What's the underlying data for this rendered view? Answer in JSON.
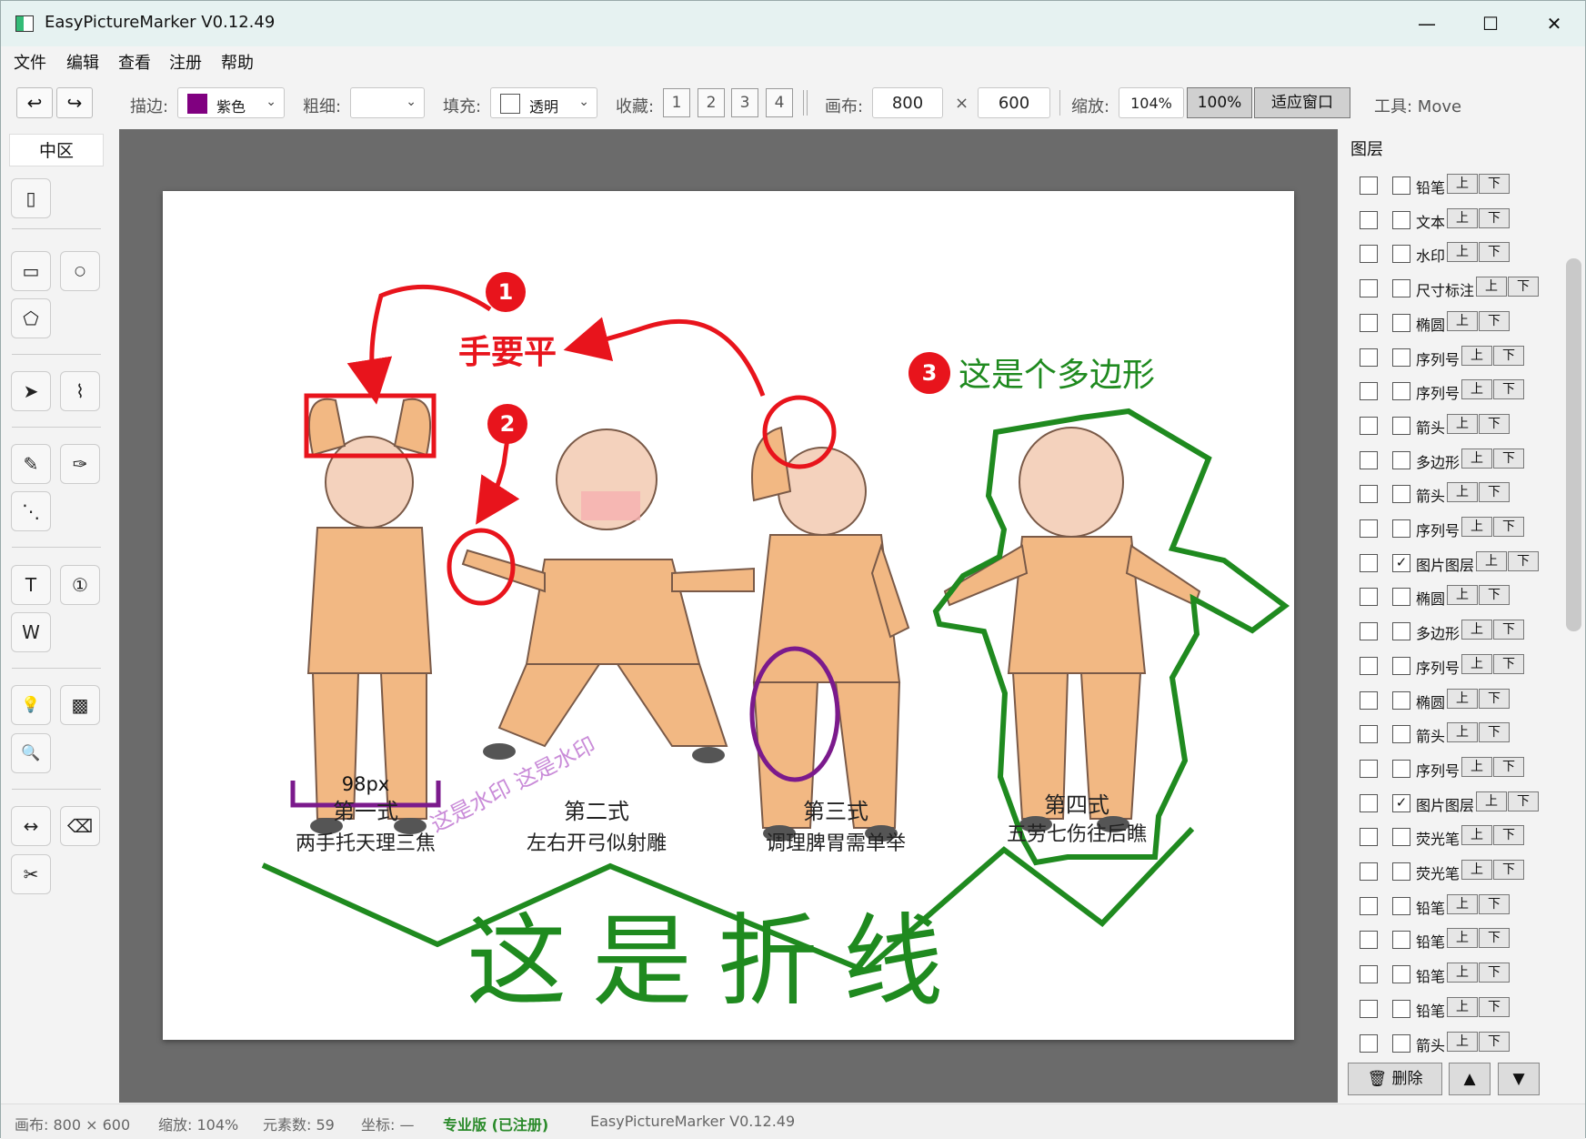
{
  "window": {
    "title": "EasyPictureMarker V0.12.49",
    "min_glyph": "—",
    "max_glyph": "☐",
    "close_glyph": "✕"
  },
  "menu": [
    "文件",
    "编辑",
    "查看",
    "注册",
    "帮助"
  ],
  "toolbar": {
    "undo_glyph": "↩",
    "redo_glyph": "↪",
    "stroke_label": "描边:",
    "stroke_value": "紫色",
    "stroke_color": "#800080",
    "width_label": "粗细:",
    "width_value": "",
    "fill_label": "填充:",
    "fill_value": "透明",
    "favorites_label": "收藏:",
    "favorites": [
      "1",
      "2",
      "3",
      "4"
    ],
    "canvas_label": "画布:",
    "canvas_width": "800",
    "times": "×",
    "canvas_height": "600",
    "zoom_label": "缩放:",
    "zoom_value": "104%",
    "zoom_100": "100%",
    "fit_window": "适应窗口",
    "tool_label": "工具: Move",
    "dropdown_glyph": "⌄"
  },
  "toolbox": {
    "tab": "中区",
    "icons": {
      "move": "▯",
      "rect": "▭",
      "ellipse": "○",
      "polygon": "⬠",
      "arrow": "➤",
      "polyline": "⌇",
      "pencil": "✎",
      "highlighter": "✑",
      "dots": "⋱",
      "text": "T",
      "sequence": "①",
      "watermark": "W",
      "hint": "💡",
      "mosaic": "▩",
      "magnifier": "🔍",
      "dimension": "↔",
      "eraser": "⌫",
      "crop": "✂"
    }
  },
  "canvas_content": {
    "step1": "1",
    "step2": "2",
    "step3": "3",
    "hand_flat": "手要平",
    "polygon_note": "这是个多边形",
    "dimension": "98px",
    "watermark": "这是水印 这是水印",
    "polyline_note": "这是折线",
    "caption1_title": "第一式",
    "caption1_sub": "两手托天理三焦",
    "caption2_title": "第二式",
    "caption2_sub": "左右开弓似射雕",
    "caption3_title": "第三式",
    "caption3_sub": "调理脾胃需单举",
    "caption4_title": "第四式",
    "caption4_sub": "五劳七伤往后瞧",
    "colors": {
      "red": "#e8141c",
      "green": "#1f8a1f",
      "purple": "#7b1a8c",
      "watermark": "#c98bd8",
      "skin": "#f4d2bd",
      "suit": "#f2b883"
    }
  },
  "layers": {
    "title": "图层",
    "up": "上",
    "down": "下",
    "items": [
      {
        "name": "铅笔",
        "checked": false
      },
      {
        "name": "文本",
        "checked": false
      },
      {
        "name": "水印",
        "checked": false
      },
      {
        "name": "尺寸标注",
        "checked": false
      },
      {
        "name": "椭圆",
        "checked": false
      },
      {
        "name": "序列号",
        "checked": false
      },
      {
        "name": "序列号",
        "checked": false
      },
      {
        "name": "箭头",
        "checked": false
      },
      {
        "name": "多边形",
        "checked": false
      },
      {
        "name": "箭头",
        "checked": false
      },
      {
        "name": "序列号",
        "checked": false
      },
      {
        "name": "图片图层",
        "checked": true
      },
      {
        "name": "椭圆",
        "checked": false
      },
      {
        "name": "多边形",
        "checked": false
      },
      {
        "name": "序列号",
        "checked": false
      },
      {
        "name": "椭圆",
        "checked": false
      },
      {
        "name": "箭头",
        "checked": false
      },
      {
        "name": "序列号",
        "checked": false
      },
      {
        "name": "图片图层",
        "checked": true
      },
      {
        "name": "荧光笔",
        "checked": false
      },
      {
        "name": "荧光笔",
        "checked": false
      },
      {
        "name": "铅笔",
        "checked": false
      },
      {
        "name": "铅笔",
        "checked": false
      },
      {
        "name": "铅笔",
        "checked": false
      },
      {
        "name": "铅笔",
        "checked": false
      },
      {
        "name": "箭头",
        "checked": false
      }
    ],
    "check_glyph": "✓",
    "delete_label": "🗑 删除",
    "move_up": "▲",
    "move_down": "▼"
  },
  "status": {
    "canvas": "画布: 800 × 600",
    "zoom": "缩放: 104%",
    "elements": "元素数: 59",
    "coords": "坐标: —",
    "edition": "专业版 (已注册)",
    "edition_color": "#2a8a2a",
    "version": "EasyPictureMarker V0.12.49"
  }
}
